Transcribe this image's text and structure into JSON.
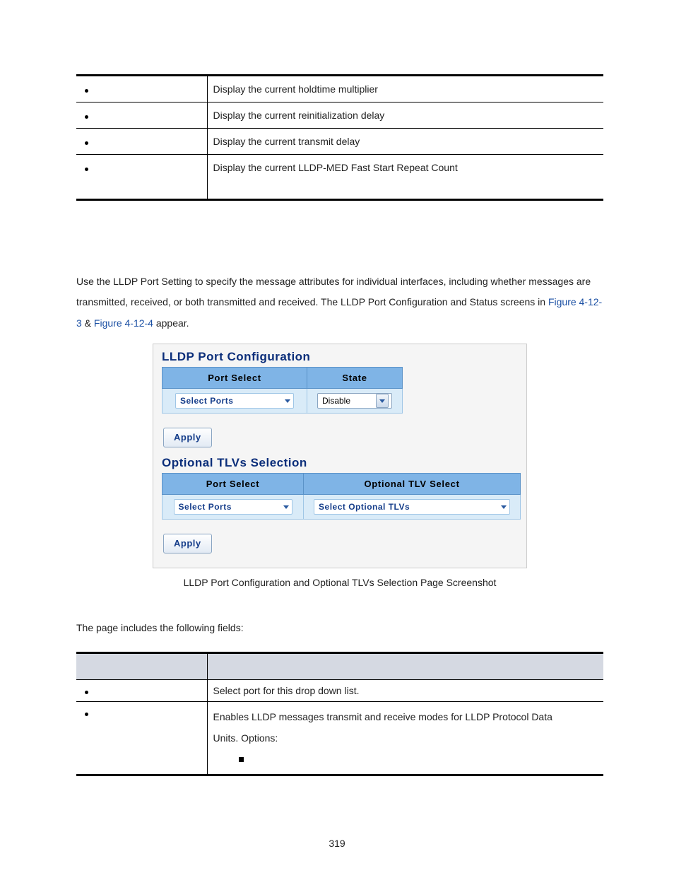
{
  "table1": {
    "rows": [
      "Display the current holdtime multiplier",
      "Display the current reinitialization delay",
      "Display the current transmit delay",
      "Display the current LLDP-MED Fast Start Repeat Count"
    ]
  },
  "para": {
    "t1": "Use the LLDP Port Setting to specify the message attributes for individual interfaces, including whether messages are transmitted, received, or both transmitted and received. The LLDP Port Configuration and Status screens in ",
    "link1": "Figure 4-12-3",
    "amp": " & ",
    "link2": "Figure 4-12-4",
    "t2": " appear."
  },
  "panel": {
    "heading1": "LLDP Port Configuration",
    "heading2": "Optional TLVs Selection",
    "th_port": "Port Select",
    "th_state": "State",
    "th_tlv": "Optional TLV Select",
    "dd_select_ports": "Select Ports",
    "dd_disable": "Disable",
    "dd_select_tlvs": "Select Optional TLVs",
    "apply": "Apply"
  },
  "caption": "LLDP Port Configuration and Optional TLVs Selection Page Screenshot",
  "fields_intro": "The page includes the following fields:",
  "table2": {
    "r1": "Select port for this drop down list.",
    "r2a": "Enables LLDP messages transmit and receive modes for LLDP Protocol Data",
    "r2b": "Units. Options:"
  },
  "page_num": "319"
}
